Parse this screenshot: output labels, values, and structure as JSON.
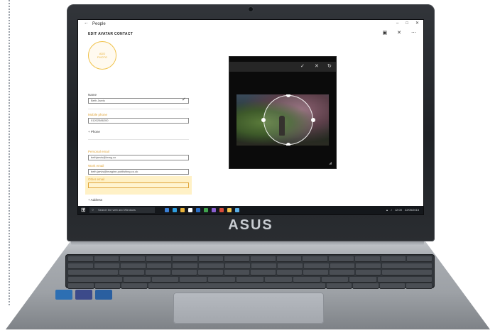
{
  "photo_description_free": true,
  "window": {
    "title": "People",
    "heading": "EDIT AVATAR CONTACT"
  },
  "avatar": {
    "text": "ADD\nPHOTO"
  },
  "form": {
    "name_label": "Name",
    "name_value": "Beth Jarvis",
    "phone_label": "Mobile phone",
    "phone_value": "01202586200",
    "add_phone": "+  Phone",
    "email_label_1": "Personal email",
    "email_value_1": "bethjarvis@imag.co",
    "email_label_2": "Work email",
    "email_value_2": "beth.jarvis@imagine-publishing.co.uk",
    "other_label": "Other email",
    "other_value": "",
    "add_address": "+  Address"
  },
  "crop": {
    "confirm_icon": "check-icon",
    "cancel_icon": "close-icon"
  },
  "taskbar": {
    "search_placeholder": "Search the web and Windows",
    "time": "12:00",
    "date": "22/05/2015"
  },
  "laptop": {
    "brand": "ASUS"
  },
  "colors": {
    "accent": "#f0c24a",
    "taskbar": "#14171b"
  }
}
